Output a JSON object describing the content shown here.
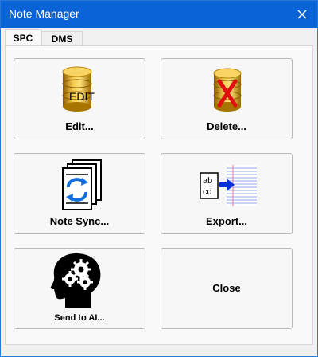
{
  "window": {
    "title": "Note Manager"
  },
  "tabs": [
    {
      "label": "SPC",
      "active": true
    },
    {
      "label": "DMS",
      "active": false
    }
  ],
  "buttons": {
    "edit": {
      "label": "Edit...",
      "icon_text": "EDIT",
      "icon": "database-edit-icon"
    },
    "delete": {
      "label": "Delete...",
      "icon": "database-delete-icon"
    },
    "sync": {
      "label": "Note Sync...",
      "icon": "document-sync-icon"
    },
    "export": {
      "label": "Export...",
      "icon_text_1": "ab",
      "icon_text_2": "cd",
      "icon": "export-notes-icon"
    },
    "ai": {
      "label": "Send to AI...",
      "icon": "head-gears-icon"
    },
    "close": {
      "label": "Close"
    }
  },
  "colors": {
    "titlebar": "#0a64d8",
    "accent": "#2a78d6"
  }
}
